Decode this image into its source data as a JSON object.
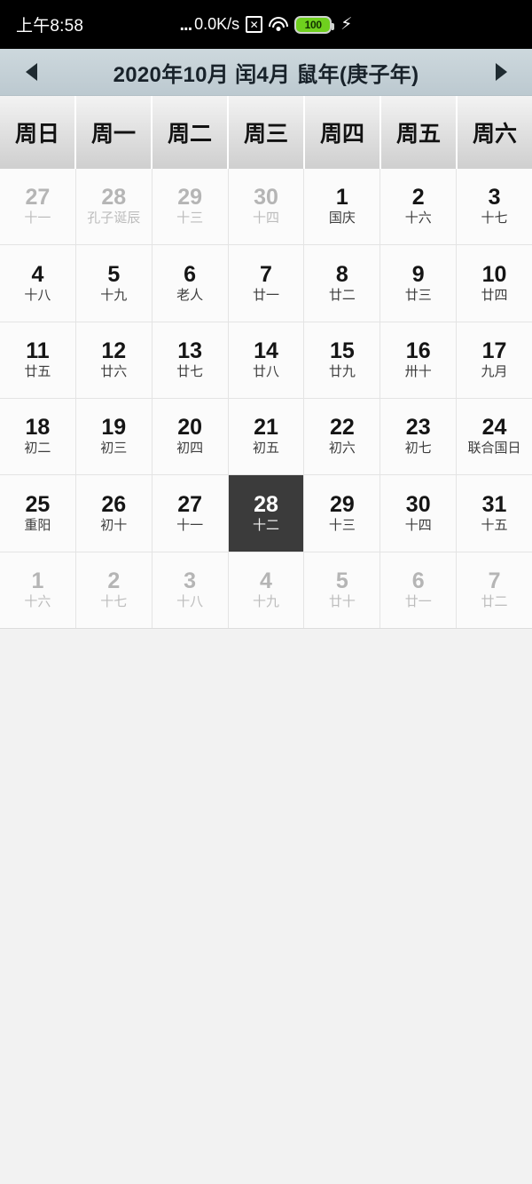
{
  "statusbar": {
    "time": "上午8:58",
    "dots": "...",
    "network_speed": "0.0K/s",
    "nosim_glyph": "✕",
    "battery_level": "100",
    "charging_glyph": "⚡"
  },
  "header": {
    "prev_label": "◀",
    "next_label": "▶",
    "title": "2020年10月 闰4月 鼠年(庚子年)"
  },
  "weekdays": [
    "周日",
    "周一",
    "周二",
    "周三",
    "周四",
    "周五",
    "周六"
  ],
  "colors": {
    "selected_bg": "#3b3b3b",
    "header_bg": "#c4d0d6",
    "battery_green": "#6fd01e",
    "cell_bg": "#fbfbfb"
  },
  "days": [
    {
      "d": "27",
      "l": "十一",
      "out": true
    },
    {
      "d": "28",
      "l": "孔子诞辰",
      "out": true
    },
    {
      "d": "29",
      "l": "十三",
      "out": true
    },
    {
      "d": "30",
      "l": "十四",
      "out": true
    },
    {
      "d": "1",
      "l": "国庆",
      "out": false
    },
    {
      "d": "2",
      "l": "十六",
      "out": false
    },
    {
      "d": "3",
      "l": "十七",
      "out": false
    },
    {
      "d": "4",
      "l": "十八",
      "out": false
    },
    {
      "d": "5",
      "l": "十九",
      "out": false
    },
    {
      "d": "6",
      "l": "老人",
      "out": false
    },
    {
      "d": "7",
      "l": "廿一",
      "out": false
    },
    {
      "d": "8",
      "l": "廿二",
      "out": false
    },
    {
      "d": "9",
      "l": "廿三",
      "out": false
    },
    {
      "d": "10",
      "l": "廿四",
      "out": false
    },
    {
      "d": "11",
      "l": "廿五",
      "out": false
    },
    {
      "d": "12",
      "l": "廿六",
      "out": false
    },
    {
      "d": "13",
      "l": "廿七",
      "out": false
    },
    {
      "d": "14",
      "l": "廿八",
      "out": false
    },
    {
      "d": "15",
      "l": "廿九",
      "out": false
    },
    {
      "d": "16",
      "l": "卅十",
      "out": false
    },
    {
      "d": "17",
      "l": "九月",
      "out": false
    },
    {
      "d": "18",
      "l": "初二",
      "out": false
    },
    {
      "d": "19",
      "l": "初三",
      "out": false
    },
    {
      "d": "20",
      "l": "初四",
      "out": false
    },
    {
      "d": "21",
      "l": "初五",
      "out": false
    },
    {
      "d": "22",
      "l": "初六",
      "out": false
    },
    {
      "d": "23",
      "l": "初七",
      "out": false
    },
    {
      "d": "24",
      "l": "联合国日",
      "out": false
    },
    {
      "d": "25",
      "l": "重阳",
      "out": false
    },
    {
      "d": "26",
      "l": "初十",
      "out": false
    },
    {
      "d": "27",
      "l": "十一",
      "out": false
    },
    {
      "d": "28",
      "l": "十二",
      "out": false,
      "selected": true
    },
    {
      "d": "29",
      "l": "十三",
      "out": false
    },
    {
      "d": "30",
      "l": "十四",
      "out": false
    },
    {
      "d": "31",
      "l": "十五",
      "out": false
    },
    {
      "d": "1",
      "l": "十六",
      "out": true
    },
    {
      "d": "2",
      "l": "十七",
      "out": true
    },
    {
      "d": "3",
      "l": "十八",
      "out": true
    },
    {
      "d": "4",
      "l": "十九",
      "out": true
    },
    {
      "d": "5",
      "l": "廿十",
      "out": true
    },
    {
      "d": "6",
      "l": "廿一",
      "out": true
    },
    {
      "d": "7",
      "l": "廿二",
      "out": true
    }
  ]
}
